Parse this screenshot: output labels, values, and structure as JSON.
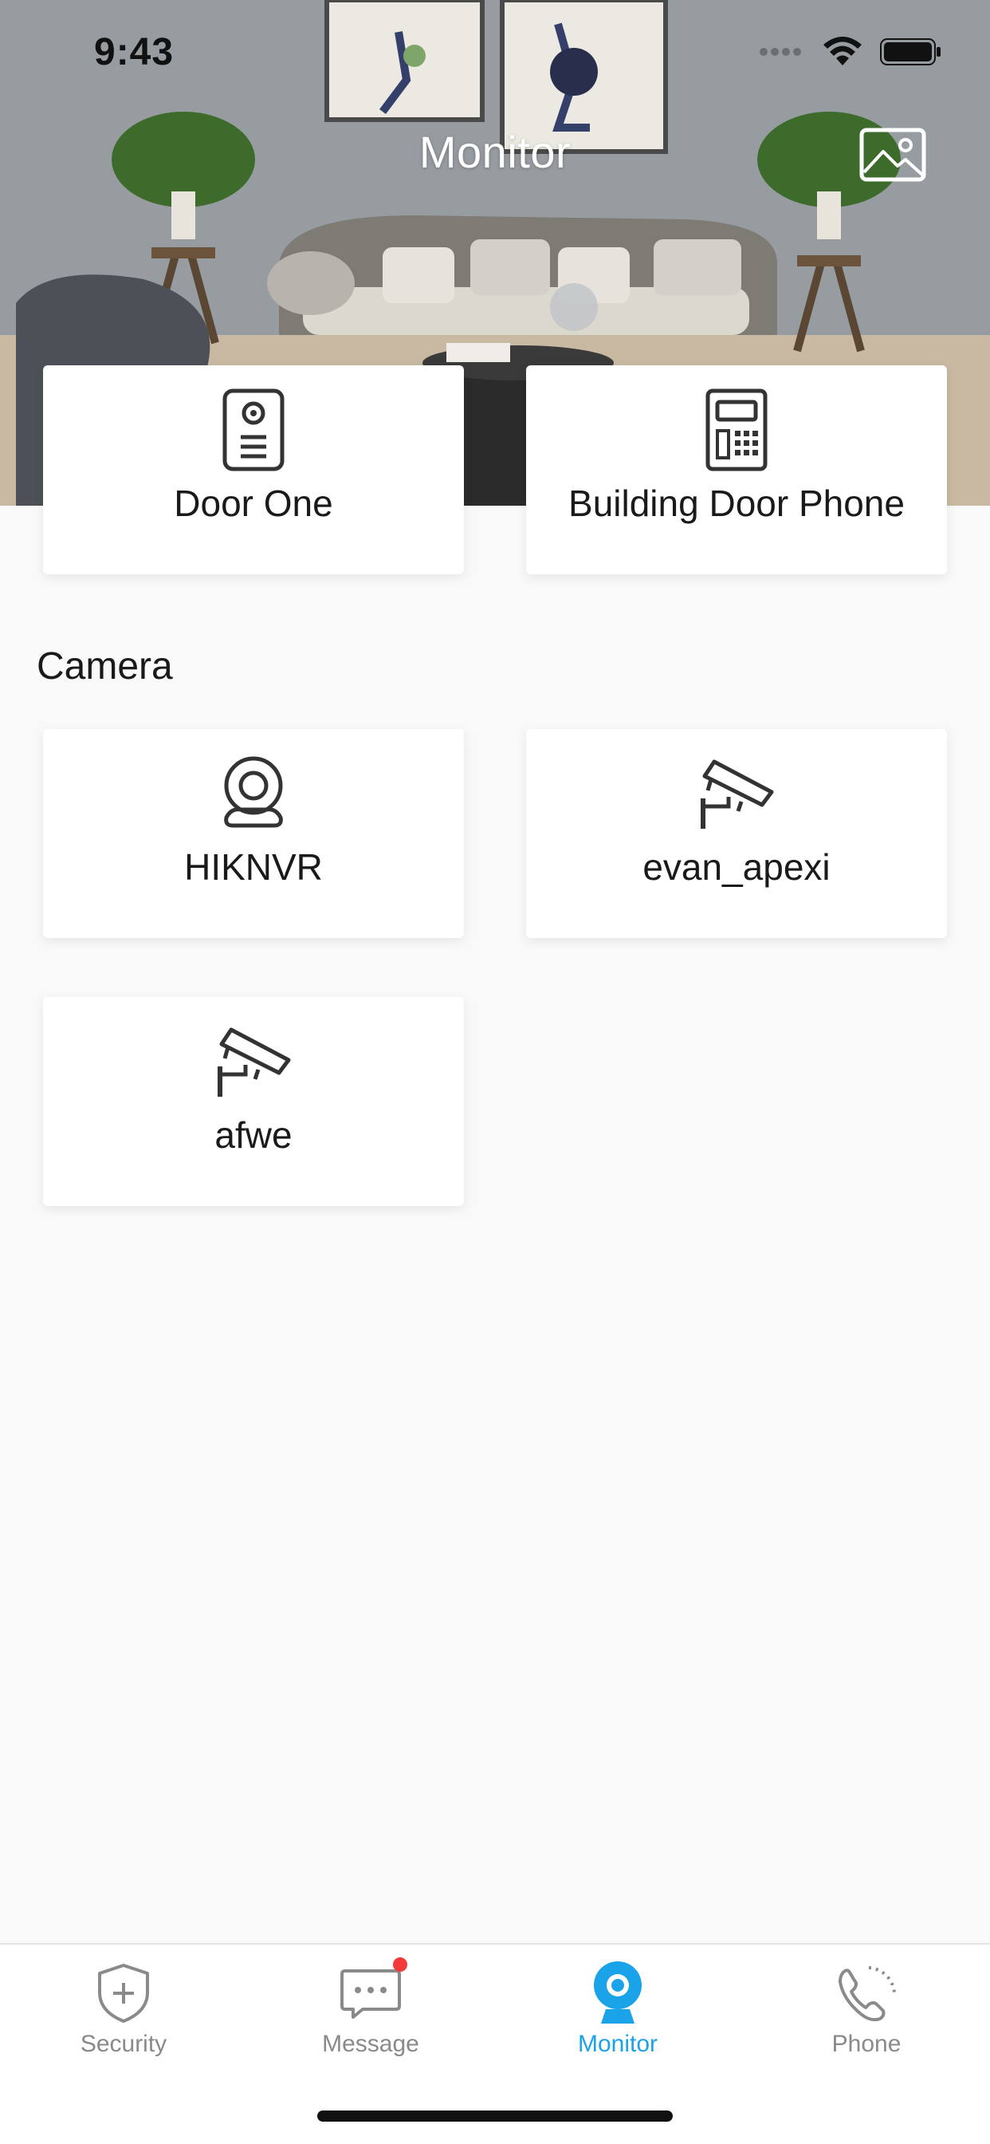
{
  "status_bar": {
    "time": "9:43"
  },
  "header": {
    "title": "Monitor",
    "wallpaper_icon": "image-icon"
  },
  "intercoms": [
    {
      "label": "Door One",
      "icon": "doorbell-icon"
    },
    {
      "label": "Building Door Phone",
      "icon": "door-phone-icon"
    }
  ],
  "camera_section": {
    "title": "Camera",
    "items": [
      {
        "label": "HIKNVR",
        "icon": "webcam-icon"
      },
      {
        "label": "evan_apexi",
        "icon": "cctv-camera-icon"
      },
      {
        "label": "afwe",
        "icon": "cctv-camera-icon"
      }
    ]
  },
  "tab_bar": {
    "active": "Monitor",
    "active_color": "#1aa3e8",
    "inactive_color": "#8a8a8a",
    "tabs": [
      {
        "label": "Security",
        "icon": "shield-icon"
      },
      {
        "label": "Message",
        "icon": "message-icon",
        "badge": true
      },
      {
        "label": "Monitor",
        "icon": "camera-icon"
      },
      {
        "label": "Phone",
        "icon": "phone-icon"
      }
    ]
  }
}
